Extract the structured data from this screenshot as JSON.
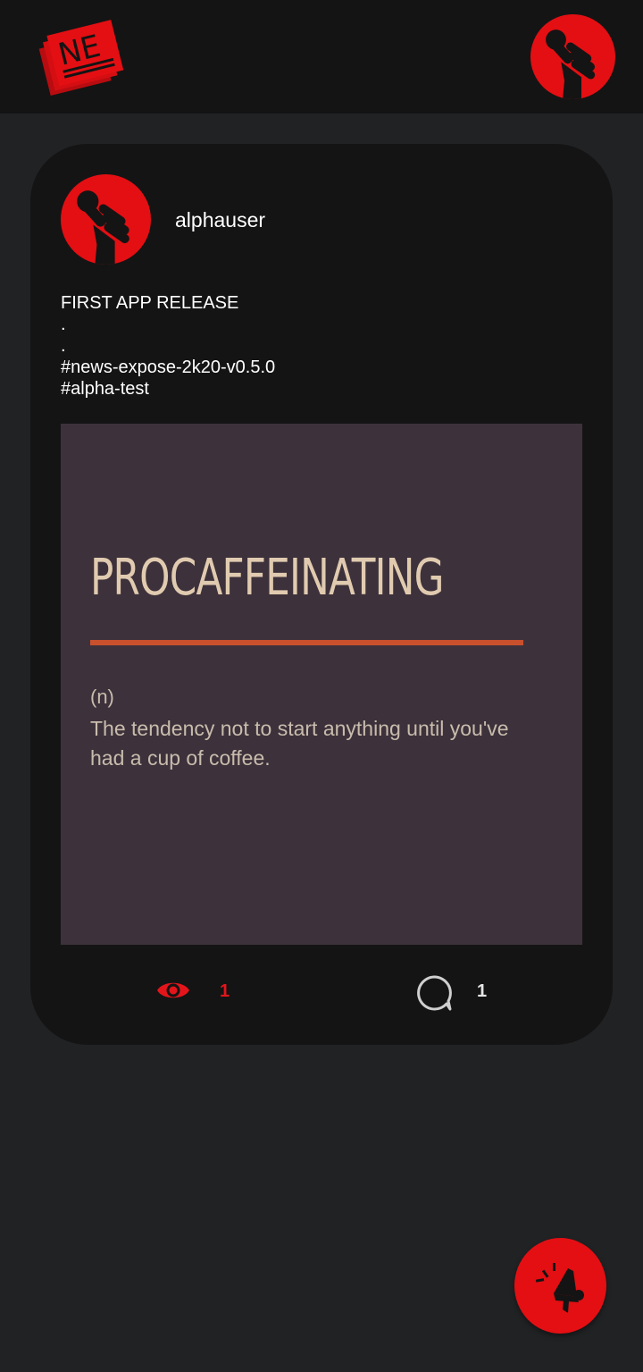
{
  "header": {
    "logo_text": "NE",
    "logo_icon": "newspaper-logo-icon",
    "profile_icon": "raised-fist-microphone-icon"
  },
  "post": {
    "author": "alphauser",
    "avatar_icon": "raised-fist-microphone-icon",
    "text_lines": [
      "FIRST APP RELEASE",
      ".",
      ".",
      "#news-expose-2k20-v0.5.0",
      "#alpha-test"
    ],
    "image": {
      "title": "PROCAFFEINATING",
      "part_of_speech": "(n)",
      "definition": "The tendency not to start anything until you've had a cup of coffee."
    },
    "views": "1",
    "comments": "1"
  },
  "fab": {
    "icon": "megaphone-icon"
  },
  "colors": {
    "accent": "#e30f13",
    "background": "#212224",
    "card": "#141414",
    "image_bg": "#3d323b",
    "image_title": "#e1cbb0",
    "image_rule": "#c8502d"
  }
}
